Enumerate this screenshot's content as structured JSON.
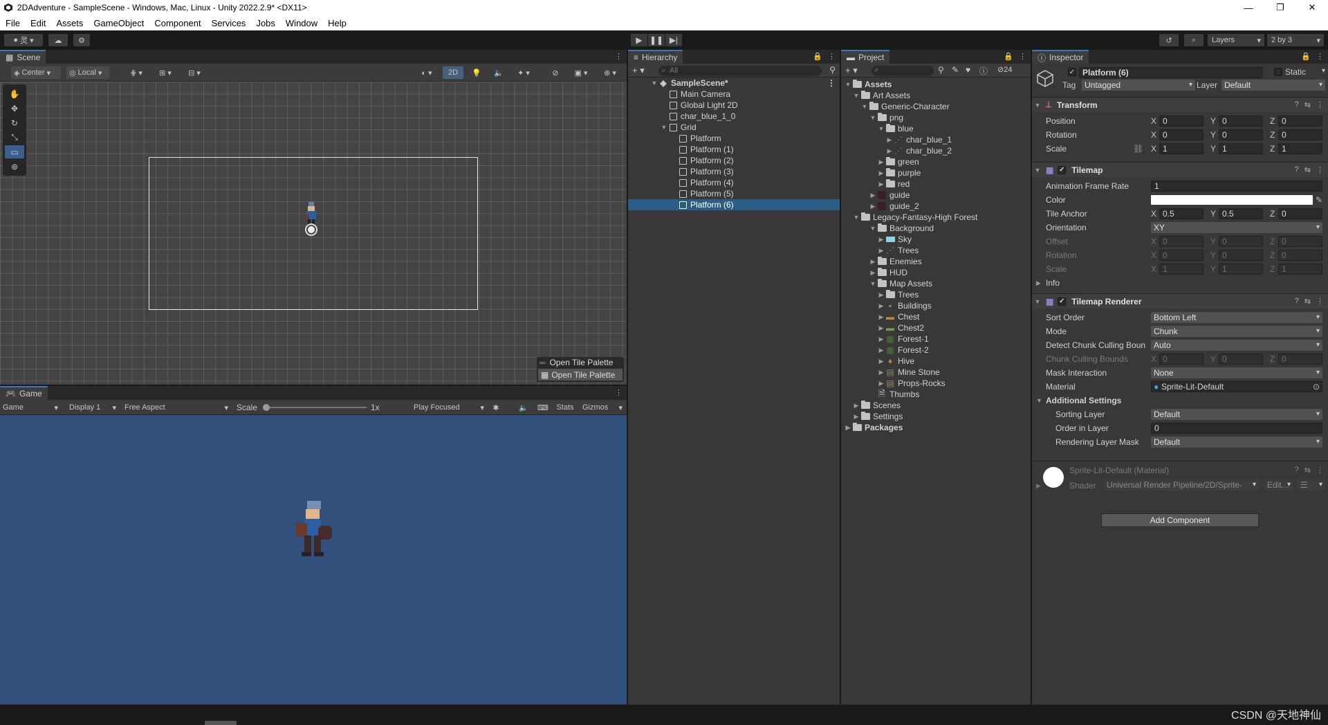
{
  "window": {
    "title": "2DAdventure - SampleScene - Windows, Mac, Linux - Unity 2022.2.9* <DX11>"
  },
  "menu": [
    "File",
    "Edit",
    "Assets",
    "GameObject",
    "Component",
    "Services",
    "Jobs",
    "Window",
    "Help"
  ],
  "toolbar": {
    "layers": "Layers",
    "layout": "2 by 3",
    "account": "灵"
  },
  "scene": {
    "tab": "Scene",
    "pivot": "Center",
    "space": "Local",
    "mode2d": "2D",
    "open_palette_1": "Open Tile Palette",
    "open_palette_2": "Open Tile Palette"
  },
  "game": {
    "tab": "Game",
    "view": "Game",
    "display": "Display 1",
    "aspect": "Free Aspect",
    "scale_label": "Scale",
    "scale_value": "1x",
    "play_mode": "Play Focused",
    "stats": "Stats",
    "gizmos": "Gizmos"
  },
  "hierarchy": {
    "tab": "Hierarchy",
    "search_placeholder": "All",
    "items": [
      {
        "label": "SampleScene*"
      },
      {
        "label": "Main Camera"
      },
      {
        "label": "Global Light 2D"
      },
      {
        "label": "char_blue_1_0"
      },
      {
        "label": "Grid"
      },
      {
        "label": "Platform"
      },
      {
        "label": "Platform (1)"
      },
      {
        "label": "Platform (2)"
      },
      {
        "label": "Platform (3)"
      },
      {
        "label": "Platform (4)"
      },
      {
        "label": "Platform (5)"
      },
      {
        "label": "Platform (6)"
      }
    ]
  },
  "project": {
    "tab": "Project",
    "hidden_count": "24",
    "items": [
      {
        "label": "Assets"
      },
      {
        "label": "Art Assets"
      },
      {
        "label": "Generic-Character"
      },
      {
        "label": "png"
      },
      {
        "label": "blue"
      },
      {
        "label": "char_blue_1"
      },
      {
        "label": "char_blue_2"
      },
      {
        "label": "green"
      },
      {
        "label": "purple"
      },
      {
        "label": "red"
      },
      {
        "label": "guide"
      },
      {
        "label": "guide_2"
      },
      {
        "label": "Legacy-Fantasy-High Forest"
      },
      {
        "label": "Background"
      },
      {
        "label": "Sky"
      },
      {
        "label": "Trees"
      },
      {
        "label": "Enemies"
      },
      {
        "label": "HUD"
      },
      {
        "label": "Map Assets"
      },
      {
        "label": "Trees"
      },
      {
        "label": "Buildings"
      },
      {
        "label": "Chest"
      },
      {
        "label": "Chest2"
      },
      {
        "label": "Forest-1"
      },
      {
        "label": "Forest-2"
      },
      {
        "label": "Hive"
      },
      {
        "label": "Mine Stone"
      },
      {
        "label": "Props-Rocks"
      },
      {
        "label": "Thumbs"
      },
      {
        "label": "Scenes"
      },
      {
        "label": "Settings"
      },
      {
        "label": "Packages"
      }
    ]
  },
  "inspector": {
    "tab": "Inspector",
    "object_name": "Platform (6)",
    "static": "Static",
    "tag_label": "Tag",
    "tag": "Untagged",
    "layer_label": "Layer",
    "layer": "Default",
    "transform": {
      "title": "Transform",
      "position": "Position",
      "rotation": "Rotation",
      "scale": "Scale",
      "px": "0",
      "py": "0",
      "pz": "0",
      "rx": "0",
      "ry": "0",
      "rz": "0",
      "sx": "1",
      "sy": "1",
      "sz": "1"
    },
    "tilemap": {
      "title": "Tilemap",
      "anim_rate_label": "Animation Frame Rate",
      "anim_rate": "1",
      "color_label": "Color",
      "color": "#ffffff",
      "anchor_label": "Tile Anchor",
      "ax": "0.5",
      "ay": "0.5",
      "az": "0",
      "orient_label": "Orientation",
      "orient": "XY",
      "offset_label": "Offset",
      "ox": "0",
      "oy": "0",
      "oz": "0",
      "rot_label": "Rotation",
      "rx": "0",
      "ry": "0",
      "rz": "0",
      "scale_label": "Scale",
      "sx": "1",
      "sy": "1",
      "sz": "1",
      "info": "Info"
    },
    "renderer": {
      "title": "Tilemap Renderer",
      "sort_label": "Sort Order",
      "sort": "Bottom Left",
      "mode_label": "Mode",
      "mode": "Chunk",
      "detect_label": "Detect Chunk Culling Boun",
      "detect": "Auto",
      "bounds_label": "Chunk Culling Bounds",
      "bx": "0",
      "by": "0",
      "bz": "0",
      "mask_label": "Mask Interaction",
      "mask": "None",
      "material_label": "Material",
      "material": "Sprite-Lit-Default",
      "additional": "Additional Settings",
      "sorting_layer_label": "Sorting Layer",
      "sorting_layer": "Default",
      "order_label": "Order in Layer",
      "order": "0",
      "rlm_label": "Rendering Layer Mask",
      "rlm": "Default"
    },
    "material": {
      "name": "Sprite-Lit-Default (Material)",
      "shader_label": "Shader",
      "shader": "Universal Render Pipeline/2D/Sprite-",
      "edit": "Edit..."
    },
    "add_component": "Add Component"
  },
  "watermark": "CSDN @天地神仙",
  "colors": {
    "accent": "#3a79bb",
    "selection": "#2c5d87",
    "game_bg": "#32507c",
    "scene_bg": "#444444"
  }
}
